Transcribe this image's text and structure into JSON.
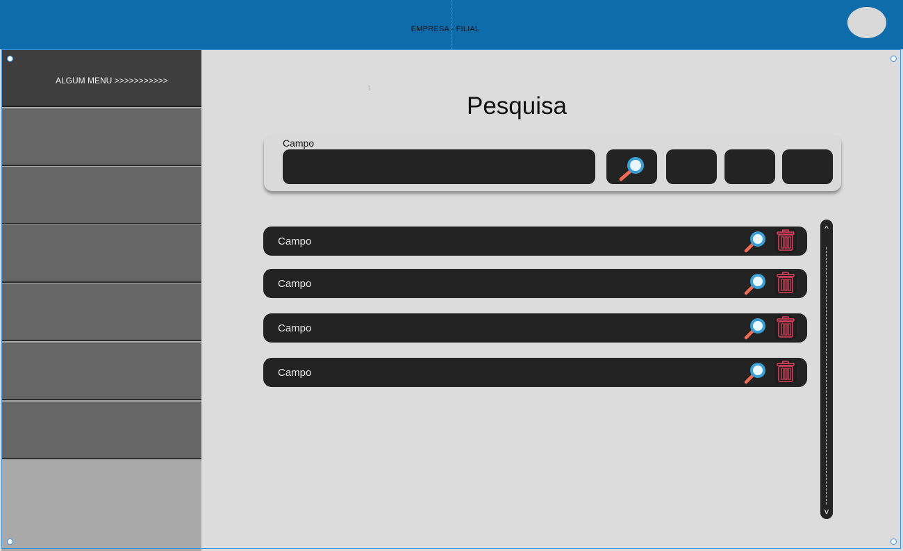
{
  "header": {
    "title": "EMPRESA - FILIAL"
  },
  "sidebar": {
    "menu_title": "ALGUM MENU >>>>>>>>>>>"
  },
  "page": {
    "title": "Pesquisa",
    "marker": "1"
  },
  "search": {
    "field_label": "Campo",
    "value": ""
  },
  "results": [
    {
      "label": "Campo"
    },
    {
      "label": "Campo"
    },
    {
      "label": "Campo"
    },
    {
      "label": "Campo"
    }
  ],
  "scroll": {
    "up": "^",
    "down": "v"
  },
  "colors": {
    "header": "#0f6cab",
    "accent_blue": "#3aa0d8",
    "delete_red": "#e0435e",
    "dark": "#232323"
  },
  "icons": {
    "search": "magnifier-icon",
    "delete": "trash-icon",
    "avatar": "avatar"
  }
}
